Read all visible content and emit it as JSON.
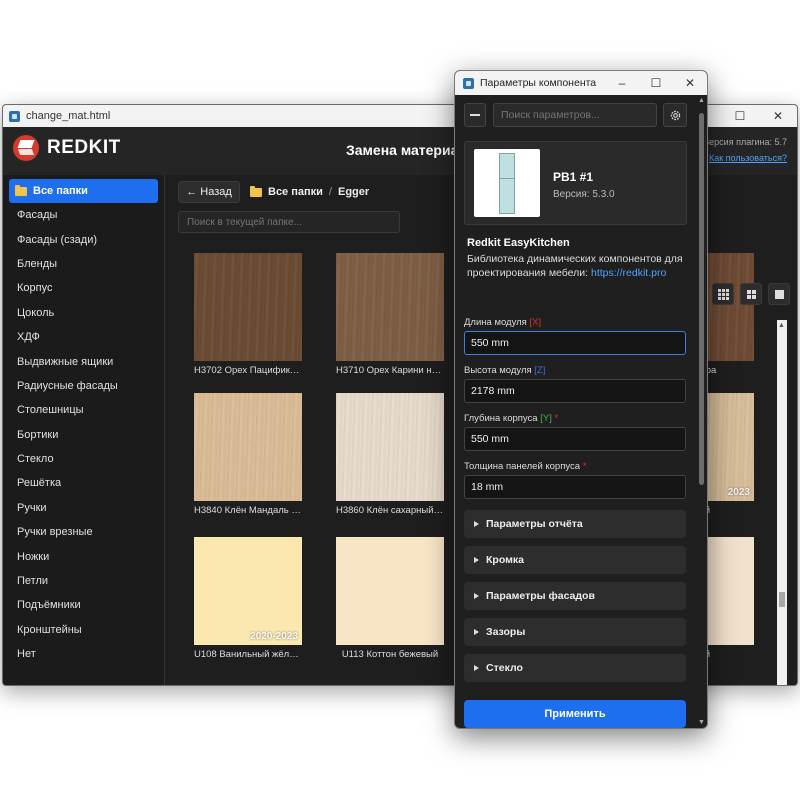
{
  "back_window": {
    "filename": "change_mat.html",
    "logo_text": "REDKIT",
    "page_title": "Замена материал",
    "plugin_version": "Версия плагина: 5.7",
    "help_link": "Как пользоваться?",
    "sidebar": {
      "items": [
        "Все папки",
        "Фасады",
        "Фасады (сзади)",
        "Бленды",
        "Корпус",
        "Цоколь",
        "ХДФ",
        "Выдвижные ящики",
        "Радиусные фасады",
        "Столешницы",
        "Бортики",
        "Стекло",
        "Решётка",
        "Ручки",
        "Ручки врезные",
        "Ножки",
        "Петли",
        "Подъёмники",
        "Кронштейны",
        "Нет"
      ]
    },
    "toolbar": {
      "back_label": "← Назад",
      "crumb_root": "Все папки",
      "crumb_separator": "/",
      "crumb_current": "Egger",
      "search_placeholder": "Поиск в текущей папке..."
    },
    "materials": [
      {
        "name": "H3702 Орех Пацифик табак",
        "color": "#6b4a32",
        "stamp": ""
      },
      {
        "name": "H3710 Орех Карини натур...",
        "color": "#7e5e44",
        "stamp": ""
      },
      {
        "name": "H3840 Клён Мандаль нату...",
        "color": "#dcbd96",
        "stamp": ""
      },
      {
        "name": "H3860 Клён сахарный шам...",
        "color": "#e9ddcc",
        "stamp": ""
      },
      {
        "name": "U108 Ванильный жёлтый",
        "color": "#fbe7b0",
        "stamp": "2020-2023"
      },
      {
        "name": "U113 Коттон бежевый",
        "color": "#f8e5c6",
        "stamp": ""
      }
    ],
    "partial_materials": [
      {
        "name": "...атура",
        "color": "#6f4a33",
        "stamp": ""
      },
      {
        "name": "...ый",
        "color": "#d9bf9b",
        "stamp": "2023"
      },
      {
        "name": "...ый",
        "color": "#f2e1cb",
        "stamp": ""
      }
    ],
    "icons": [
      "grid-3x3-icon",
      "grid-2x2-icon",
      "grid-1x1-icon"
    ]
  },
  "dialog": {
    "title": "Параметры компонента",
    "search_placeholder": "Поиск параметров...",
    "component": {
      "name": "PB1 #1",
      "version": "Версия: 5.3.0"
    },
    "library": {
      "title": "Redkit EasyKitchen",
      "description": "Библиотека динамических компонентов для проектирования мебели: ",
      "link": "https://redkit.pro"
    },
    "fields": [
      {
        "label": "Длина модуля",
        "tag": "[X]",
        "tag_color": "#e03030",
        "required": "",
        "value": "550 mm"
      },
      {
        "label": "Высота модуля",
        "tag": "[Z]",
        "tag_color": "#3d6de0",
        "required": "",
        "value": "2178 mm"
      },
      {
        "label": "Глубина корпуса",
        "tag": "[Y]",
        "tag_color": "#3fb44a",
        "required": "*",
        "value": "550 mm"
      },
      {
        "label": "Толщина панелей корпуса",
        "tag": "",
        "tag_color": "",
        "required": "*",
        "value": "18 mm"
      }
    ],
    "sections": [
      "Параметры отчёта",
      "Кромка",
      "Параметры фасадов",
      "Зазоры",
      "Стекло"
    ],
    "apply_label": "Применить",
    "accent_color": "#1e6ff0"
  }
}
